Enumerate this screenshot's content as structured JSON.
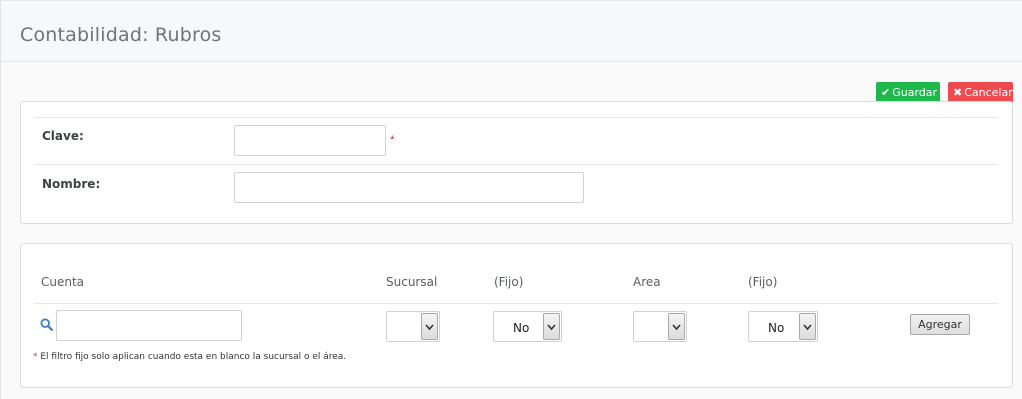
{
  "header": {
    "title": "Contabilidad: Rubros"
  },
  "toolbar": {
    "save_label": "Guardar",
    "save_icon": "check-icon",
    "cancel_label": "Cancelar",
    "cancel_icon": "times-icon",
    "save_color": "#1fb84a",
    "cancel_color": "#ef4a50"
  },
  "form": {
    "clave_label": "Clave:",
    "clave_value": "",
    "clave_required_mark": "*",
    "nombre_label": "Nombre:",
    "nombre_value": ""
  },
  "detail": {
    "columns": {
      "cuenta": "Cuenta",
      "sucursal": "Sucursal",
      "fijo1": "(Fijo)",
      "area": "Area",
      "fijo2": "(Fijo)"
    },
    "cuenta_value": "",
    "sucursal_value": "",
    "fijo1_value": "No",
    "area_value": "",
    "fijo2_value": "No",
    "add_label": "Agregar",
    "note_mark": "*",
    "note": "El filtro fijo solo aplican cuando esta en blanco la sucursal o el área."
  }
}
